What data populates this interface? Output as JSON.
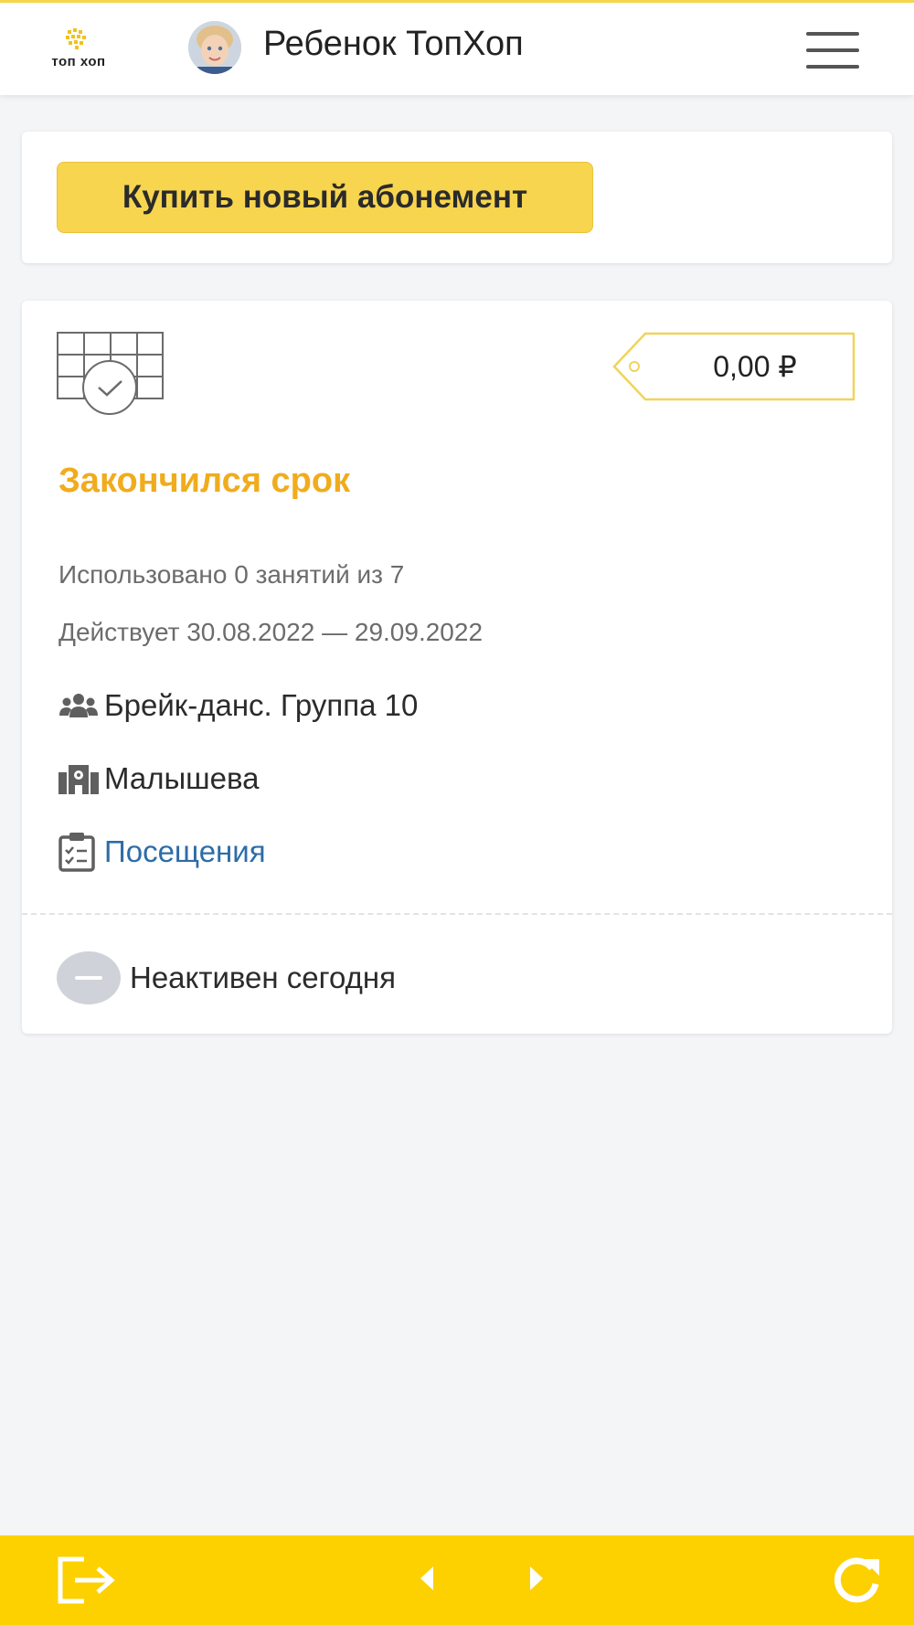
{
  "header": {
    "logo_text": "топ хоп",
    "user_name": "Ребенок ТопХоп",
    "menu_icon": "hamburger-menu-icon"
  },
  "buy_card": {
    "button_label": "Купить новый абонемент"
  },
  "subscription": {
    "price": "0,00 ₽",
    "status": "Закончился срок",
    "usage": "Использовано 0 занятий из 7",
    "validity": "Действует 30.08.2022 — 29.09.2022",
    "group": "Брейк-данс. Группа 10",
    "location": "Малышева",
    "visits_link": "Посещения",
    "today_status": "Неактивен сегодня"
  },
  "colors": {
    "accent_yellow": "#f8d54e",
    "bottom_bar": "#fdd000",
    "status_orange": "#f0ac1d",
    "link_blue": "#2d6ca8"
  },
  "bottom_bar": {
    "icons": [
      "logout-icon",
      "prev-arrow-icon",
      "next-arrow-icon",
      "refresh-icon"
    ]
  }
}
